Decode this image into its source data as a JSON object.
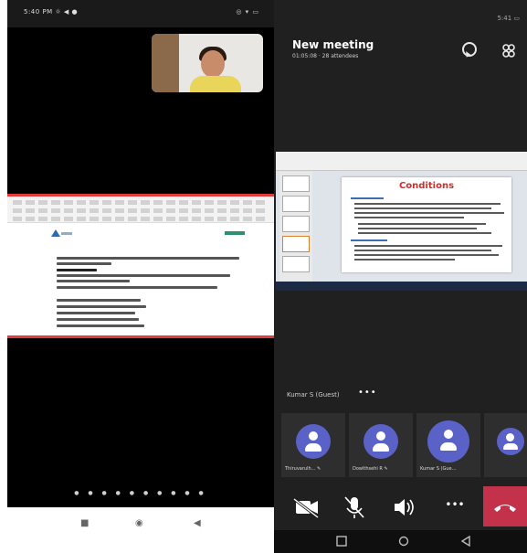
{
  "left_phone": {
    "status_time": "5:40 PM ☼ ◀ ●",
    "status_icons": "◎ ▾ ▭",
    "pagination_dots": "● ● ● ● ● ● ● ● ● ●",
    "nav": {
      "menu_glyph": "■",
      "home_glyph": "◉",
      "back_glyph": "◀"
    }
  },
  "right_phone": {
    "status": "5:41 ▭",
    "meeting": {
      "title": "New meeting",
      "subtitle": "01:05:08 · 28 attendees"
    },
    "shared_slide": {
      "title": "Conditions"
    },
    "presenter_label": "Kumar S (Guest)",
    "more_glyph": "•••",
    "participants": [
      {
        "name": "Thiruvarulh... ✎"
      },
      {
        "name": "Dowlthsehi R ✎"
      },
      {
        "name": "Kumar S (Gue..."
      },
      {
        "name": ""
      }
    ],
    "controls": {
      "camera": "camera-off-icon",
      "mic": "mic-off-icon",
      "speaker": "speaker-icon",
      "more": "•••",
      "hangup": "hang-up-icon"
    },
    "colors": {
      "hangup": "#c4314b",
      "avatar": "#5b62c7",
      "share_border": "#e23b3b"
    }
  }
}
